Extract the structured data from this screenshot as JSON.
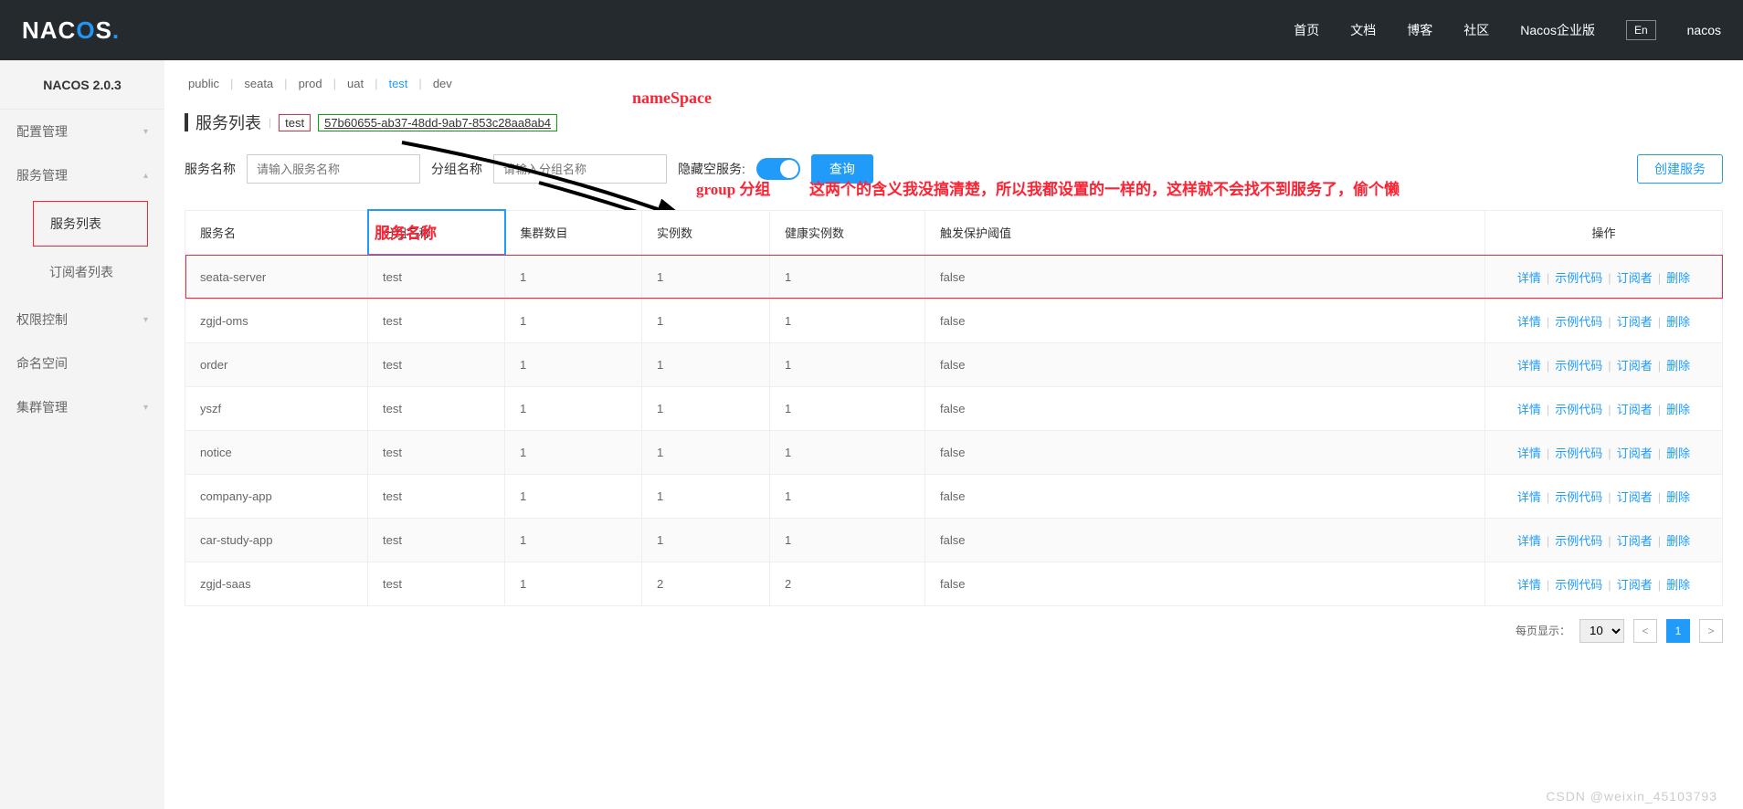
{
  "header": {
    "brand_prefix": "NAC",
    "brand_o": "O",
    "brand_suffix": "S",
    "nav": [
      "首页",
      "文档",
      "博客",
      "社区",
      "Nacos企业版"
    ],
    "lang_label": "En",
    "user": "nacos"
  },
  "sidebar": {
    "version": "NACOS 2.0.3",
    "menus": [
      {
        "label": "配置管理",
        "expanded": false
      },
      {
        "label": "服务管理",
        "expanded": true,
        "children": [
          {
            "label": "服务列表",
            "active": true
          },
          {
            "label": "订阅者列表",
            "active": false
          }
        ]
      },
      {
        "label": "权限控制",
        "expanded": false
      },
      {
        "label": "命名空间",
        "expanded": false
      },
      {
        "label": "集群管理",
        "expanded": false
      }
    ]
  },
  "namespaces": {
    "items": [
      {
        "label": "public",
        "active": false
      },
      {
        "label": "seata",
        "active": false
      },
      {
        "label": "prod",
        "active": false
      },
      {
        "label": "uat",
        "active": false
      },
      {
        "label": "test",
        "active": true
      },
      {
        "label": "dev",
        "active": false
      }
    ]
  },
  "page": {
    "title": "服务列表",
    "ns_name": "test",
    "ns_id": "57b60655-ab37-48dd-9ab7-853c28aa8ab4",
    "anno_namespace": "nameSpace",
    "anno_service_name": "服务名称",
    "anno_group": "group 分组",
    "anno_note": "这两个的含义我没搞清楚，所以我都设置的一样的，这样就不会找不到服务了，偷个懒"
  },
  "filters": {
    "service_label": "服务名称",
    "service_placeholder": "请输入服务名称",
    "group_label": "分组名称",
    "group_placeholder": "请输入分组名称",
    "hide_empty_label": "隐藏空服务:",
    "query_btn": "查询",
    "create_btn": "创建服务"
  },
  "table": {
    "headers": [
      "服务名",
      "分组名称",
      "集群数目",
      "实例数",
      "健康实例数",
      "触发保护阈值",
      "操作"
    ],
    "rows": [
      {
        "name": "seata-server",
        "group": "test",
        "clusters": "1",
        "instances": "1",
        "healthy": "1",
        "threshold": "false",
        "hl": true
      },
      {
        "name": "zgjd-oms",
        "group": "test",
        "clusters": "1",
        "instances": "1",
        "healthy": "1",
        "threshold": "false"
      },
      {
        "name": "order",
        "group": "test",
        "clusters": "1",
        "instances": "1",
        "healthy": "1",
        "threshold": "false"
      },
      {
        "name": "yszf",
        "group": "test",
        "clusters": "1",
        "instances": "1",
        "healthy": "1",
        "threshold": "false"
      },
      {
        "name": "notice",
        "group": "test",
        "clusters": "1",
        "instances": "1",
        "healthy": "1",
        "threshold": "false"
      },
      {
        "name": "company-app",
        "group": "test",
        "clusters": "1",
        "instances": "1",
        "healthy": "1",
        "threshold": "false"
      },
      {
        "name": "car-study-app",
        "group": "test",
        "clusters": "1",
        "instances": "1",
        "healthy": "1",
        "threshold": "false"
      },
      {
        "name": "zgjd-saas",
        "group": "test",
        "clusters": "1",
        "instances": "2",
        "healthy": "2",
        "threshold": "false"
      }
    ],
    "actions": {
      "detail": "详情",
      "code": "示例代码",
      "sub": "订阅者",
      "del": "删除"
    }
  },
  "pager": {
    "per_page_label": "每页显示：",
    "per_page_value": "10",
    "current": "1"
  },
  "watermark": "CSDN @weixin_45103793"
}
